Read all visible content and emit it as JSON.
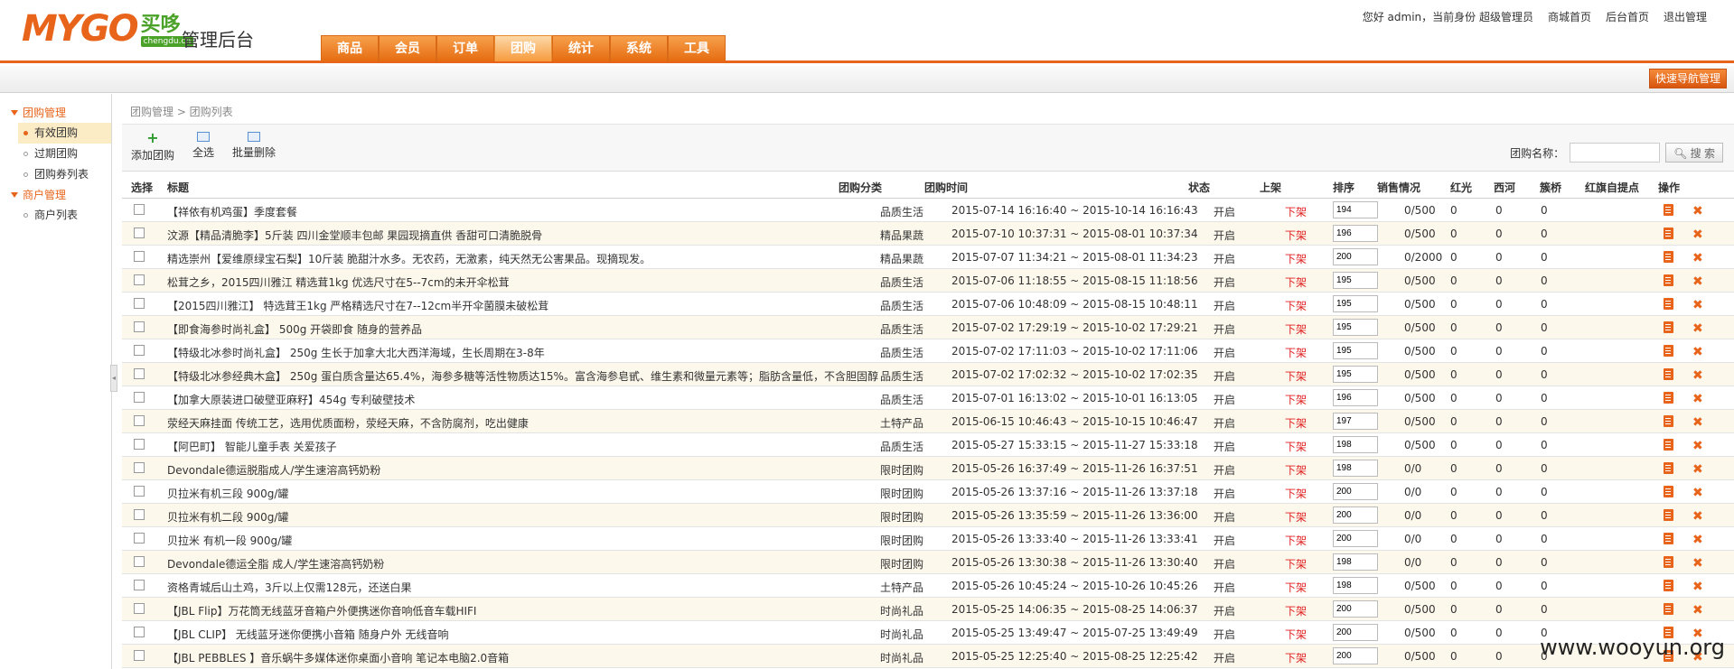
{
  "brand": {
    "logo_main": "MYGO",
    "logo_cn": "买哆",
    "logo_url": "chengdu.cn",
    "admin_title": "管理后台"
  },
  "nav": {
    "tabs": [
      "商品",
      "会员",
      "订单",
      "团购",
      "统计",
      "系统",
      "工具"
    ],
    "active": "团购"
  },
  "top_links": {
    "greeting": "您好 admin，当前身份 超级管理员",
    "mall_home": "商城首页",
    "admin_home": "后台首页",
    "logout": "退出管理"
  },
  "quick_nav_label": "快速导航管理",
  "sidebar": {
    "groups": [
      {
        "title": "团购管理",
        "items": [
          "有效团购",
          "过期团购",
          "团购券列表"
        ]
      },
      {
        "title": "商户管理",
        "items": [
          "商户列表"
        ]
      }
    ],
    "active_item": "有效团购"
  },
  "breadcrumb": "团购管理 > 团购列表",
  "actions": {
    "add": "添加团购",
    "select_all": "全选",
    "batch_delete": "批量删除"
  },
  "search": {
    "label": "团购名称：",
    "value": "",
    "button": "搜 索"
  },
  "columns": [
    "选择",
    "标题",
    "团购分类",
    "团购时间",
    "状态",
    "上架",
    "排序",
    "销售情况",
    "红光",
    "西河",
    "簇桥",
    "红旗自提点",
    "操作"
  ],
  "rows": [
    {
      "title": "【祥依有机鸡蛋】季度套餐",
      "category": "品质生活",
      "time": "2015-07-14 16:16:40 ~ 2015-10-14 16:16:43",
      "status": "开启",
      "shelf": "下架",
      "sort": "194",
      "sales": "0/500",
      "hg": "0",
      "xh": "0",
      "cq": "0"
    },
    {
      "title": "汶源【精品清脆李】5斤装 四川金堂顺丰包邮 果园现摘直供 香甜可口清脆脱骨",
      "category": "精品果蔬",
      "time": "2015-07-10 10:37:31 ~ 2015-08-01 10:37:34",
      "status": "开启",
      "shelf": "下架",
      "sort": "196",
      "sales": "0/500",
      "hg": "0",
      "xh": "0",
      "cq": "0"
    },
    {
      "title": "精选崇州【爱维原绿宝石梨】10斤装 脆甜汁水多。无农药，无激素，纯天然无公害果品。现摘现发。",
      "category": "精品果蔬",
      "time": "2015-07-07 11:34:21 ~ 2015-08-01 11:34:23",
      "status": "开启",
      "shelf": "下架",
      "sort": "200",
      "sales": "0/2000",
      "hg": "0",
      "xh": "0",
      "cq": "0"
    },
    {
      "title": "松茸之乡，2015四川雅江 精选茸1kg 优选尺寸在5--7cm的未开伞松茸",
      "category": "品质生活",
      "time": "2015-07-06 11:18:55 ~ 2015-08-15 11:18:56",
      "status": "开启",
      "shelf": "下架",
      "sort": "195",
      "sales": "0/500",
      "hg": "0",
      "xh": "0",
      "cq": "0"
    },
    {
      "title": "【2015四川雅江】 特选茸王1kg 严格精选尺寸在7--12cm半开伞菌膜未破松茸",
      "category": "品质生活",
      "time": "2015-07-06 10:48:09 ~ 2015-08-15 10:48:11",
      "status": "开启",
      "shelf": "下架",
      "sort": "195",
      "sales": "0/500",
      "hg": "0",
      "xh": "0",
      "cq": "0"
    },
    {
      "title": "【即食海参时尚礼盒】 500g 开袋即食 随身的营养品",
      "category": "品质生活",
      "time": "2015-07-02 17:29:19 ~ 2015-10-02 17:29:21",
      "status": "开启",
      "shelf": "下架",
      "sort": "195",
      "sales": "0/500",
      "hg": "0",
      "xh": "0",
      "cq": "0"
    },
    {
      "title": "【特级北冰参时尚礼盒】 250g 生长于加拿大北大西洋海域，生长周期在3-8年",
      "category": "品质生活",
      "time": "2015-07-02 17:11:03 ~ 2015-10-02 17:11:06",
      "status": "开启",
      "shelf": "下架",
      "sort": "195",
      "sales": "0/500",
      "hg": "0",
      "xh": "0",
      "cq": "0"
    },
    {
      "title": "【特级北冰参经典木盒】 250g 蛋白质含量达65.4%，海参多糖等活性物质达15%。富含海参皂甙、维生素和微量元素等；脂肪含量低，不含胆固醇",
      "category": "品质生活",
      "time": "2015-07-02 17:02:32 ~ 2015-10-02 17:02:35",
      "status": "开启",
      "shelf": "下架",
      "sort": "195",
      "sales": "0/500",
      "hg": "0",
      "xh": "0",
      "cq": "0"
    },
    {
      "title": "【加拿大原装进口破壁亚麻籽】454g 专利破壁技术",
      "category": "品质生活",
      "time": "2015-07-01 16:13:02 ~ 2015-10-01 16:13:05",
      "status": "开启",
      "shelf": "下架",
      "sort": "196",
      "sales": "0/500",
      "hg": "0",
      "xh": "0",
      "cq": "0"
    },
    {
      "title": "荥经天麻挂面 传统工艺，选用优质面粉，荥经天麻，不含防腐剂，吃出健康",
      "category": "土特产品",
      "time": "2015-06-15 10:46:43 ~ 2015-10-15 10:46:47",
      "status": "开启",
      "shelf": "下架",
      "sort": "197",
      "sales": "0/500",
      "hg": "0",
      "xh": "0",
      "cq": "0"
    },
    {
      "title": "【阿巴町】 智能儿童手表 关爱孩子",
      "category": "品质生活",
      "time": "2015-05-27 15:33:15 ~ 2015-11-27 15:33:18",
      "status": "开启",
      "shelf": "下架",
      "sort": "198",
      "sales": "0/500",
      "hg": "0",
      "xh": "0",
      "cq": "0"
    },
    {
      "title": "Devondale德运脱脂成人/学生速溶高钙奶粉",
      "category": "限时团购",
      "time": "2015-05-26 16:37:49 ~ 2015-11-26 16:37:51",
      "status": "开启",
      "shelf": "下架",
      "sort": "198",
      "sales": "0/0",
      "hg": "0",
      "xh": "0",
      "cq": "0"
    },
    {
      "title": "贝拉米有机三段 900g/罐",
      "category": "限时团购",
      "time": "2015-05-26 13:37:16 ~ 2015-11-26 13:37:18",
      "status": "开启",
      "shelf": "下架",
      "sort": "200",
      "sales": "0/0",
      "hg": "0",
      "xh": "0",
      "cq": "0"
    },
    {
      "title": "贝拉米有机二段 900g/罐",
      "category": "限时团购",
      "time": "2015-05-26 13:35:59 ~ 2015-11-26 13:36:00",
      "status": "开启",
      "shelf": "下架",
      "sort": "200",
      "sales": "0/0",
      "hg": "0",
      "xh": "0",
      "cq": "0"
    },
    {
      "title": "贝拉米 有机一段 900g/罐",
      "category": "限时团购",
      "time": "2015-05-26 13:33:40 ~ 2015-11-26 13:33:41",
      "status": "开启",
      "shelf": "下架",
      "sort": "200",
      "sales": "0/0",
      "hg": "0",
      "xh": "0",
      "cq": "0"
    },
    {
      "title": "Devondale德运全脂 成人/学生速溶高钙奶粉",
      "category": "限时团购",
      "time": "2015-05-26 13:30:38 ~ 2015-11-26 13:30:40",
      "status": "开启",
      "shelf": "下架",
      "sort": "198",
      "sales": "0/0",
      "hg": "0",
      "xh": "0",
      "cq": "0"
    },
    {
      "title": "资格青城后山土鸡，3斤以上仅需128元，还送白果",
      "category": "土特产品",
      "time": "2015-05-26 10:45:24 ~ 2015-10-26 10:45:26",
      "status": "开启",
      "shelf": "下架",
      "sort": "198",
      "sales": "0/500",
      "hg": "0",
      "xh": "0",
      "cq": "0"
    },
    {
      "title": "【JBL Flip】万花筒无线蓝牙音箱户外便携迷你音响低音车载HIFI",
      "category": "时尚礼品",
      "time": "2015-05-25 14:06:35 ~ 2015-08-25 14:06:37",
      "status": "开启",
      "shelf": "下架",
      "sort": "200",
      "sales": "0/500",
      "hg": "0",
      "xh": "0",
      "cq": "0"
    },
    {
      "title": "【JBL CLIP】 无线蓝牙迷你便携小音箱 随身户外 无线音响",
      "category": "时尚礼品",
      "time": "2015-05-25 13:49:47 ~ 2015-07-25 13:49:49",
      "status": "开启",
      "shelf": "下架",
      "sort": "200",
      "sales": "0/500",
      "hg": "0",
      "xh": "0",
      "cq": "0"
    },
    {
      "title": "【JBL PEBBLES 】音乐蜗牛多媒体迷你桌面小音响 笔记本电脑2.0音箱",
      "category": "时尚礼品",
      "time": "2015-05-25 12:25:40 ~ 2015-08-25 12:25:42",
      "status": "开启",
      "shelf": "下架",
      "sort": "200",
      "sales": "0/500",
      "hg": "0",
      "xh": "0",
      "cq": "0"
    }
  ],
  "watermark": "www.wooyun.org",
  "colors": {
    "accent": "#e8641b",
    "green": "#4aa228",
    "down": "#e02020",
    "row_alt": "#fdf8ec"
  }
}
